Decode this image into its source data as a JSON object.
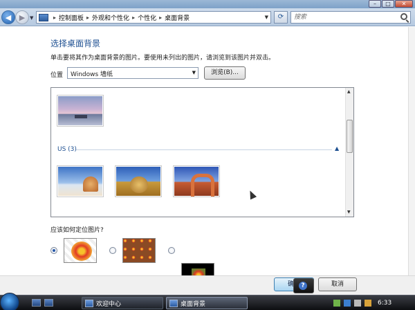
{
  "window": {
    "controls": {
      "minimize": "–",
      "maximize": "□",
      "close": "✕"
    }
  },
  "navbar": {
    "back_glyph": "◀",
    "forward_glyph": "▶",
    "breadcrumbs": [
      "控制面板",
      "外观和个性化",
      "个性化",
      "桌面背景"
    ],
    "refresh_glyph": "⟳",
    "search_placeholder": "搜索"
  },
  "page": {
    "title": "选择桌面背景",
    "description": "单击要将其作为桌面背景的图片。要使用未列出的图片，请浏览到该图片并双击。",
    "location_label": "位置",
    "location_value": "Windows 墙纸",
    "browse_label": "浏览(B)...",
    "group_label": "US (3)",
    "group_toggle": "▲",
    "position_question": "应该如何定位图片?",
    "position_options": [
      "fill",
      "tile",
      "center"
    ],
    "position_selected": "fill"
  },
  "buttons": {
    "ok": "确定",
    "cancel": "取消",
    "help": "?"
  },
  "taskbar": {
    "tasks": [
      {
        "label": "欢迎中心",
        "active": false
      },
      {
        "label": "桌面背景",
        "active": true
      }
    ],
    "clock": "6:33"
  },
  "colors": {
    "title_blue": "#1d4f91",
    "taskbar_dark": "#0d0e11"
  }
}
